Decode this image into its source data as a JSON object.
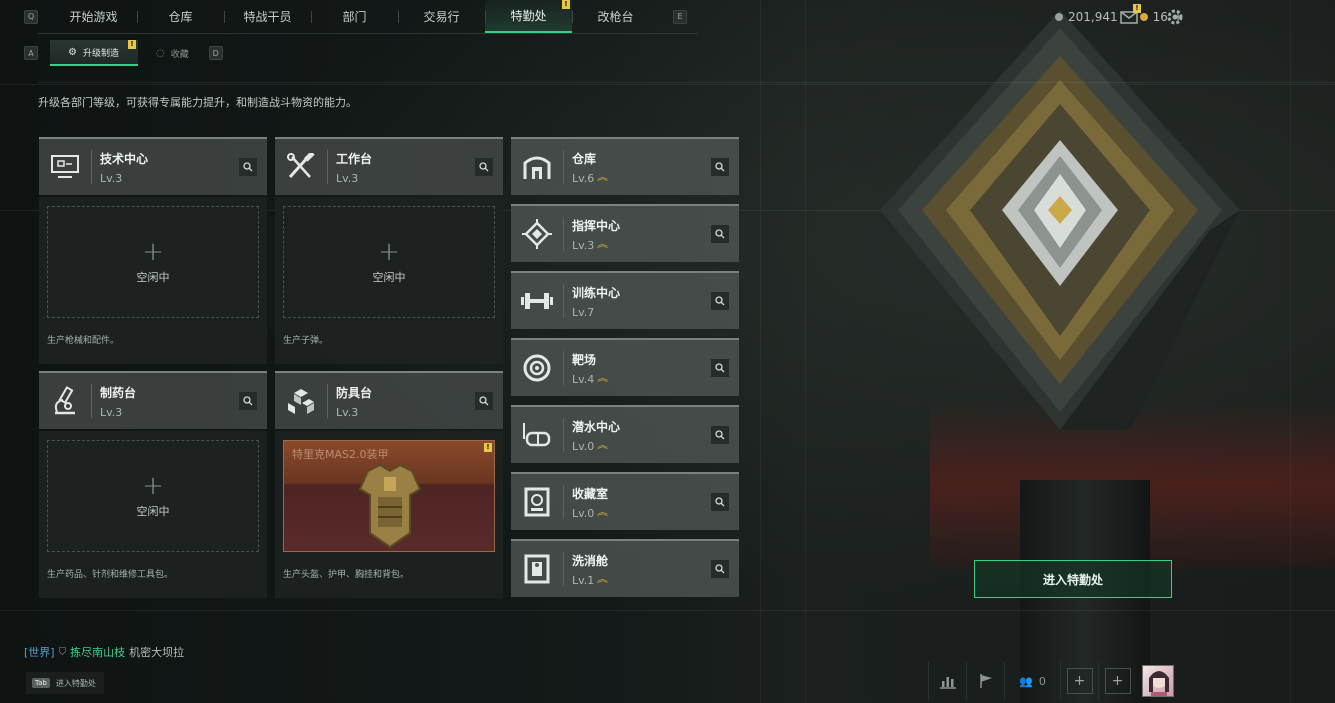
{
  "nav": {
    "left_key": "Q",
    "right_key": "E",
    "tabs": [
      {
        "label": "开始游戏"
      },
      {
        "label": "仓库"
      },
      {
        "label": "特战干员"
      },
      {
        "label": "部门"
      },
      {
        "label": "交易行"
      },
      {
        "label": "特勤处",
        "active": true,
        "badge": "!"
      },
      {
        "label": "改枪台"
      }
    ]
  },
  "resources": {
    "currency": "201,941",
    "premium": "16",
    "premium_plus": "+",
    "mail_badge": "!"
  },
  "subnav": {
    "left_key": "A",
    "right_key": "D",
    "tabs": [
      {
        "label": "升级制造",
        "active": true,
        "badge": "!"
      },
      {
        "label": "收藏"
      }
    ]
  },
  "description": "升级各部门等级，可获得专属能力提升，和制造战斗物资的能力。",
  "workstations": [
    {
      "name": "技术中心",
      "level": "Lv.3",
      "slot": {
        "plus": "+",
        "state": "空闲中"
      },
      "caption": "生产枪械和配件。"
    },
    {
      "name": "工作台",
      "level": "Lv.3",
      "slot": {
        "plus": "+",
        "state": "空闲中"
      },
      "caption": "生产子弹。"
    },
    {
      "name": "制药台",
      "level": "Lv.3",
      "slot": {
        "plus": "+",
        "state": "空闲中"
      },
      "caption": "生产药品、针剂和维修工具包。"
    },
    {
      "name": "防具台",
      "level": "Lv.3",
      "item": {
        "name": "特里克MAS2.0装甲",
        "badge": "!"
      },
      "caption": "生产头盔、护甲、胸挂和背包。"
    }
  ],
  "facilities": [
    {
      "name": "仓库",
      "level": "Lv.6",
      "upgradable": true,
      "icon": "warehouse-icon"
    },
    {
      "name": "指挥中心",
      "level": "Lv.3",
      "upgradable": true,
      "icon": "chip-icon"
    },
    {
      "name": "训练中心",
      "level": "Lv.7",
      "upgradable": false,
      "icon": "dumbbell-icon"
    },
    {
      "name": "靶场",
      "level": "Lv.4",
      "upgradable": true,
      "icon": "target-icon"
    },
    {
      "name": "潜水中心",
      "level": "Lv.0",
      "upgradable": true,
      "icon": "diving-mask-icon"
    },
    {
      "name": "收藏室",
      "level": "Lv.0",
      "upgradable": true,
      "icon": "vault-icon"
    },
    {
      "name": "洗消舱",
      "level": "Lv.1",
      "upgradable": true,
      "icon": "decon-pod-icon"
    }
  ],
  "enter_button": "进入特勤处",
  "chat": {
    "channel": "[世界]",
    "sender": "拣尽南山枝",
    "message": "机密大坝拉"
  },
  "hint": {
    "key": "Tab",
    "label": "进入特勤处"
  },
  "bottom": {
    "friends_count": "0",
    "plus1": "+",
    "plus2": "+"
  },
  "colors": {
    "accent": "#34d08a",
    "badge": "#e8c64a",
    "upgrade": "#e3b23c"
  }
}
